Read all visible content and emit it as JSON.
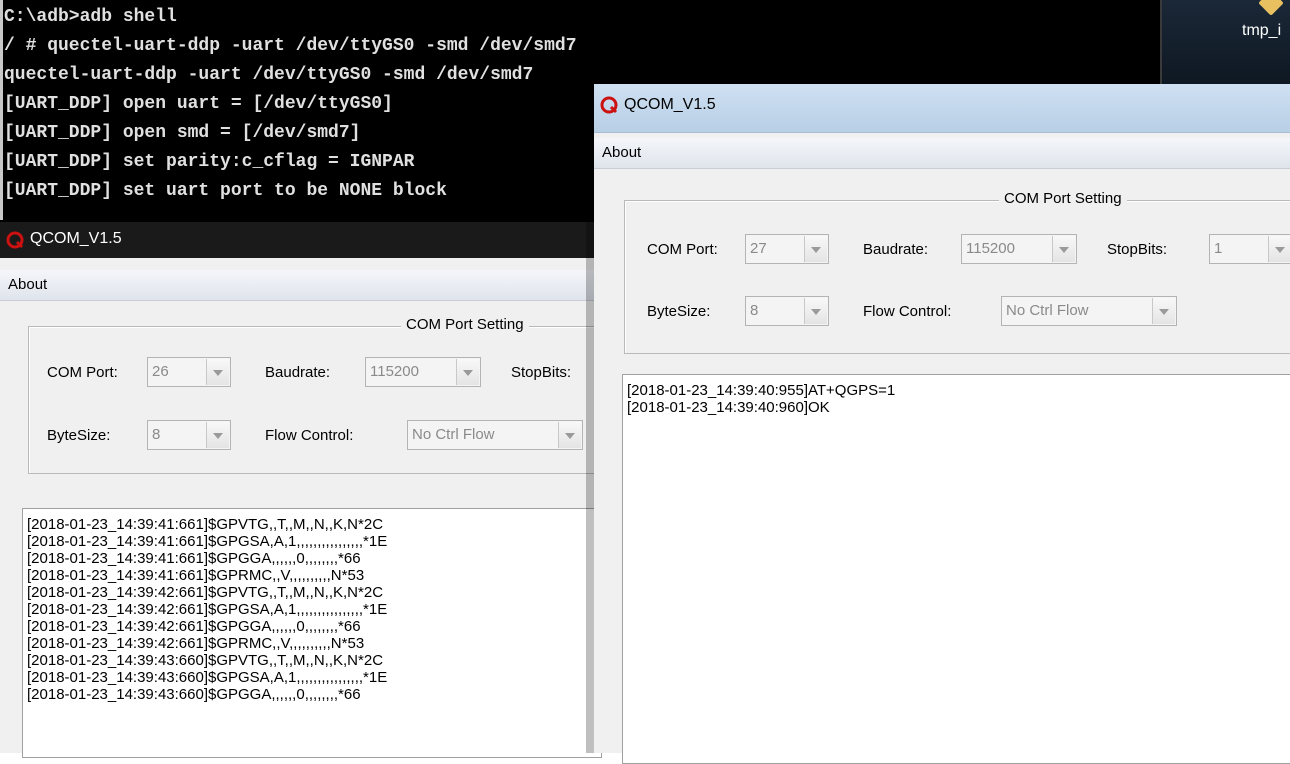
{
  "console": {
    "lines": [
      "C:\\adb>adb shell",
      "/ # quectel-uart-ddp -uart /dev/ttyGS0 -smd /dev/smd7",
      "quectel-uart-ddp -uart /dev/ttyGS0 -smd /dev/smd7",
      "[UART_DDP] open uart = [/dev/ttyGS0]",
      "[UART_DDP] open smd = [/dev/smd7]",
      "[UART_DDP] set parity:c_cflag = IGNPAR",
      "[UART_DDP] set uart port to be NONE block"
    ]
  },
  "desktop": {
    "item_label": "tmp_i"
  },
  "window_left": {
    "title": "QCOM_V1.5",
    "menu_about": "About",
    "group_title": "COM Port Setting",
    "com_port_label": "COM Port:",
    "com_port_value": "26",
    "baudrate_label": "Baudrate:",
    "baudrate_value": "115200",
    "stopbits_label": "StopBits:",
    "bytesize_label": "ByteSize:",
    "bytesize_value": "8",
    "flow_label": "Flow Control:",
    "flow_value": "No Ctrl Flow",
    "log": [
      "[2018-01-23_14:39:41:661]$GPVTG,,T,,M,,N,,K,N*2C",
      "[2018-01-23_14:39:41:661]$GPGSA,A,1,,,,,,,,,,,,,,,,*1E",
      "[2018-01-23_14:39:41:661]$GPGGA,,,,,,0,,,,,,,,*66",
      "[2018-01-23_14:39:41:661]$GPRMC,,V,,,,,,,,,,N*53",
      "[2018-01-23_14:39:42:661]$GPVTG,,T,,M,,N,,K,N*2C",
      "[2018-01-23_14:39:42:661]$GPGSA,A,1,,,,,,,,,,,,,,,,*1E",
      "[2018-01-23_14:39:42:661]$GPGGA,,,,,,0,,,,,,,,*66",
      "[2018-01-23_14:39:42:661]$GPRMC,,V,,,,,,,,,,N*53",
      "[2018-01-23_14:39:43:660]$GPVTG,,T,,M,,N,,K,N*2C",
      "[2018-01-23_14:39:43:660]$GPGSA,A,1,,,,,,,,,,,,,,,,*1E",
      "[2018-01-23_14:39:43:660]$GPGGA,,,,,,0,,,,,,,,*66"
    ]
  },
  "window_right": {
    "title": "QCOM_V1.5",
    "menu_about": "About",
    "group_title": "COM Port Setting",
    "com_port_label": "COM Port:",
    "com_port_value": "27",
    "baudrate_label": "Baudrate:",
    "baudrate_value": "115200",
    "stopbits_label": "StopBits:",
    "stopbits_value": "1",
    "bytesize_label": "ByteSize:",
    "bytesize_value": "8",
    "flow_label": "Flow Control:",
    "flow_value": "No Ctrl Flow",
    "log": [
      "[2018-01-23_14:39:40:955]AT+QGPS=1",
      "[2018-01-23_14:39:40:960]OK"
    ]
  },
  "icons": {
    "app": "qcom-q-logo-icon",
    "combo": "chevron-down-icon"
  },
  "colors": {
    "console_bg": "#000000",
    "console_text": "#e0e0e0",
    "window_bg": "#f0f0f0",
    "disabled_text": "#8a8a8a",
    "logo_red": "#cc1111"
  }
}
